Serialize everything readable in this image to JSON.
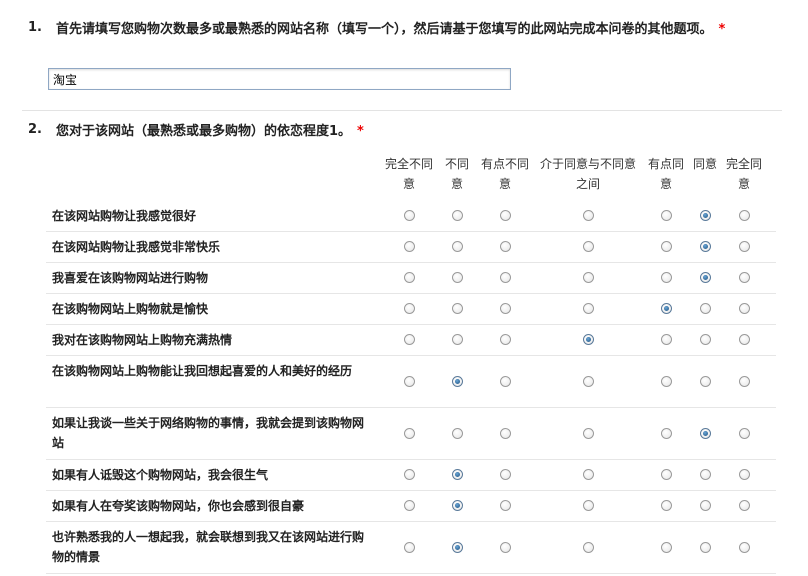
{
  "q1": {
    "number": "1.",
    "title": "首先请填写您购物次数最多或最熟悉的网站名称（填写一个），然后请基于您填写的此网站完成本问卷的其他题项。",
    "required": "*",
    "answer": "淘宝"
  },
  "q2": {
    "number": "2.",
    "title": "您对于该网站（最熟悉或最多购物）的依恋程度1。",
    "required": "*",
    "columns": [
      "完全不同意",
      "不同意",
      "有点不同意",
      "介于同意与不同意之间",
      "有点同意",
      "同意",
      "完全同意"
    ],
    "rows": [
      {
        "label": "在该网站购物让我感觉很好",
        "selected": 5
      },
      {
        "label": "在该网站购物让我感觉非常快乐",
        "selected": 5
      },
      {
        "label": "我喜爱在该购物网站进行购物",
        "selected": 5
      },
      {
        "label": "在该购物网站上购物就是愉快",
        "selected": 4
      },
      {
        "label": "我对在该购物网站上购物充满热情",
        "selected": 3
      },
      {
        "label": "在该购物网站上购物能让我回想起喜爱的人和美好的经历",
        "selected": 1
      },
      {
        "label": "如果让我谈一些关于网络购物的事情，我就会提到该购物网站",
        "selected": 5
      },
      {
        "label": "如果有人诋毁这个购物网站，我会很生气",
        "selected": 1
      },
      {
        "label": "如果有人在夸奖该购物网站，你也会感到很自豪",
        "selected": 1
      },
      {
        "label": "也许熟悉我的人一想起我，就会联想到我又在该网站进行购物的情景",
        "selected": 1
      }
    ]
  }
}
